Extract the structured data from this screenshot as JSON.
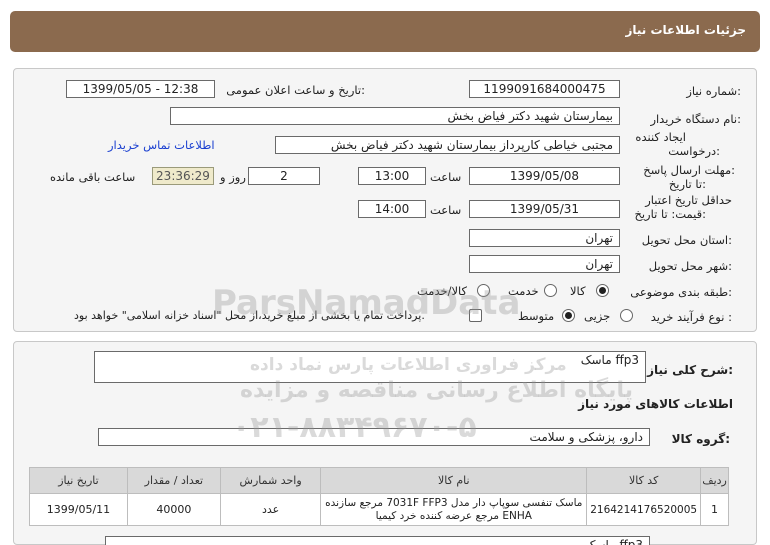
{
  "header": {
    "title": "جزئیات اطلاعات نیاز"
  },
  "form": {
    "need_number_label": "شماره نیاز:",
    "need_number": "1199091684000475",
    "announce_label": "تاریخ و ساعت اعلان عمومی:",
    "announce_value": "1399/05/05 - 12:38",
    "buyer_label": "نام دستگاه خریدار:",
    "buyer_value": "بیمارستان شهید دکتر فیاض بخش",
    "creator_label_1": "ایجاد کننده",
    "creator_label_2": "درخواست:",
    "creator_value": "مجتبی خیاطی کارپرداز بیمارستان شهید دکتر فیاض بخش",
    "contact_link": "اطلاعات تماس خریدار",
    "deadline_label_1": "مهلت ارسال پاسخ:",
    "deadline_label_2": "تا تاریخ:",
    "deadline_date": "1399/05/08",
    "time_label": "ساعت",
    "deadline_time": "13:00",
    "days_value": "2",
    "days_label": "روز و",
    "timer_value": "23:36:29",
    "remaining_label": "ساعت باقی مانده",
    "validity_label_1": "حداقل تاریخ اعتبار",
    "validity_label_2": "قیمت: تا تاریخ:",
    "validity_date": "1399/05/31",
    "validity_time": "14:00",
    "province_label": "استان محل تحویل:",
    "province_value": "تهران",
    "city_label": "شهر محل تحویل:",
    "city_value": "تهران",
    "category_label": "طبقه بندی موضوعی:",
    "category_options": [
      "کالا",
      "خدمت",
      "کالا/خدمت"
    ],
    "process_label": "نوع فرآیند خرید :",
    "process_options": [
      "جزیی",
      "متوسط"
    ],
    "payment_note": "پرداخت تمام یا بخشی از مبلغ خرید،از محل \"اسناد خزانه اسلامی\" خواهد بود."
  },
  "details": {
    "summary_label": "شرح کلی نیاز:",
    "summary_value": "ماسک ffp3",
    "goods_info_title": "اطلاعات کالاهای مورد نیاز",
    "group_label": "گروه کالا:",
    "group_value": "دارو، پزشکی و سلامت",
    "table_headers": [
      "ردیف",
      "کد کالا",
      "نام کالا",
      "واحد شمارش",
      "تعداد / مقدار",
      "تاریخ نیاز"
    ],
    "rows": [
      {
        "row": "1",
        "code": "2164214176520005",
        "name_line1": "ماسک تنفسی سوپاپ دار مدل 7031F FFP3 مرجع سازنده",
        "name_line2": "ENHA مرجع عرضه کننده خرد کیمیا",
        "unit": "عدد",
        "qty": "40000",
        "date": "1399/05/11"
      }
    ],
    "bottom_box_value": "ماسک ffp3"
  },
  "watermark": {
    "line1": "ParsNamadData",
    "line2": "مرکز فراوری اطلاعات پارس نماد داده",
    "line3": "پایگاه اطلاع رسانی مناقصه و مزایده",
    "line4": "۰۲۱-۸۸۳۴۹۶۷۰-۵"
  }
}
